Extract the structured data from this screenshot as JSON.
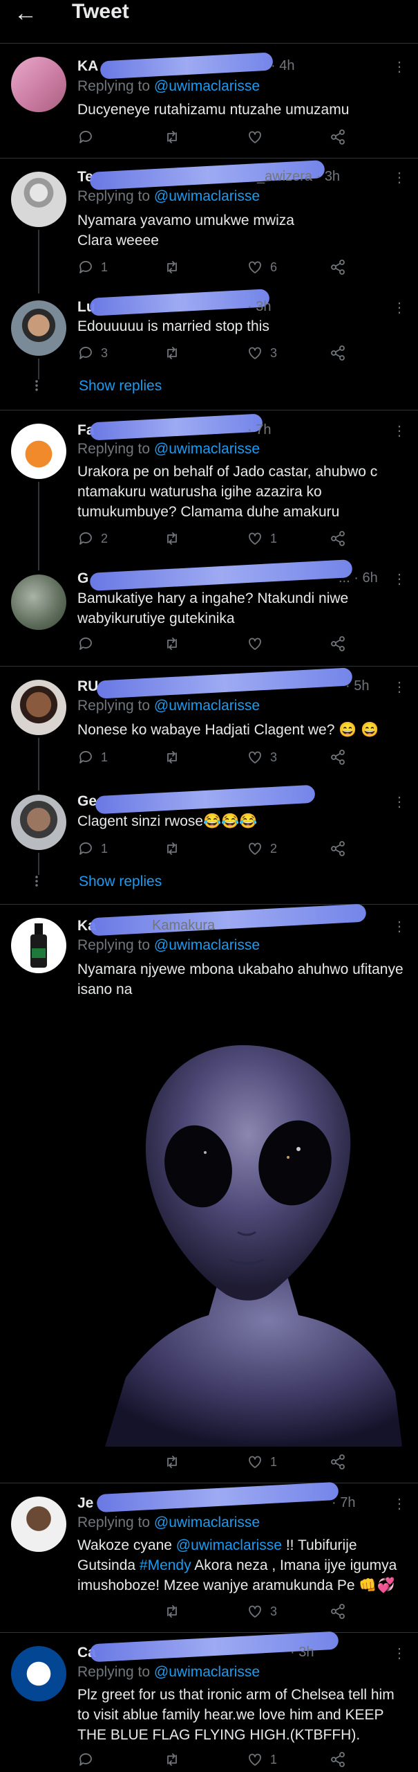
{
  "header": {
    "back_icon": "arrow-left-icon",
    "title": "Tweet"
  },
  "tweets": [
    {
      "name": "KA",
      "time": "· 4h",
      "replying_prefix": "Replying to ",
      "replying_handle": "@uwimaclarisse",
      "text": "Ducyeneye rutahizamu ntuzahe umuzamu",
      "reply_count": "",
      "like_count": ""
    },
    {
      "name": "Te",
      "time": "_awizera · 3h",
      "replying_prefix": "Replying to ",
      "replying_handle": "@uwimaclarisse",
      "text_line1": "Nyamara yavamo umukwe mwiza",
      "text_line2": "Clara weeee",
      "reply_count": "1",
      "like_count": "6"
    },
    {
      "name": "Lu",
      "time": "· 3h",
      "text": "Edouuuuu is married stop this",
      "reply_count": "3",
      "like_count": "3"
    },
    {
      "name": "Fa",
      "time": "· 7h",
      "replying_prefix": "Replying to ",
      "replying_handle": "@uwimaclarisse",
      "text_line1": "Urakora pe on behalf of Jado castar, ahubwo c",
      "text_line2": "ntamakuru waturusha igihe azazira ko",
      "text_line3": "tumukumbuye? Clamama duhe amakuru",
      "reply_count": "2",
      "like_count": "1"
    },
    {
      "name": "G",
      "time": "... · 6h",
      "text_line1": "Bamukatiye hary a ingahe? Ntakundi niwe",
      "text_line2": "wabyikurutiye gutekinika",
      "reply_count": "",
      "like_count": ""
    },
    {
      "name": "RU",
      "time": "· 5h",
      "replying_prefix": "Replying to ",
      "replying_handle": "@uwimaclarisse",
      "text": "Nonese ko wabaye Hadjati Clagent we? 😄 😄",
      "reply_count": "1",
      "like_count": "3"
    },
    {
      "name": "Ge",
      "time": "",
      "text": "Clagent sinzi rwose😂😂😂",
      "reply_count": "1",
      "like_count": "2"
    },
    {
      "name": "Ka",
      "time": "Kamakura",
      "replying_prefix": "Replying to ",
      "replying_handle": "@uwimaclarisse",
      "text_line1": "Nyamara njyewe mbona ukabaho ahuhwo ufitanye",
      "text_line2": "isano na",
      "reply_count": "",
      "like_count": "1"
    },
    {
      "name": "Je",
      "time": "· 7h",
      "replying_prefix": "Replying to ",
      "replying_handle": "@uwimaclarisse",
      "text_pre1": "Wakoze cyane ",
      "mention": "@uwimaclarisse",
      "text_post1": "  !! Tubifurije",
      "text_pre2": "Gutsinda ",
      "hashtag": "#Mendy",
      "text_post2": " Akora neza , Imana ijye igumya",
      "text_line3": "imushoboze!  Mzee wanjye aramukunda Pe 👊💞",
      "reply_count": "",
      "like_count": "3"
    },
    {
      "name": "Ca",
      "time": "· 3h",
      "replying_prefix": "Replying to ",
      "replying_handle": "@uwimaclarisse",
      "text_line1": "Plz greet for us that ironic arm of Chelsea tell him",
      "text_line2": "to visit ablue family hear.we love him and KEEP",
      "text_line3": "THE BLUE FLAG FLYING HIGH.(KTBFFH).",
      "reply_count": "",
      "like_count": "1"
    }
  ],
  "show_replies_label": "Show replies",
  "show_replies_label_2": "Show replies",
  "colors": {
    "background": "#000000",
    "link": "#1d9bf0",
    "muted": "#71767b",
    "text": "#e7e9ea"
  }
}
